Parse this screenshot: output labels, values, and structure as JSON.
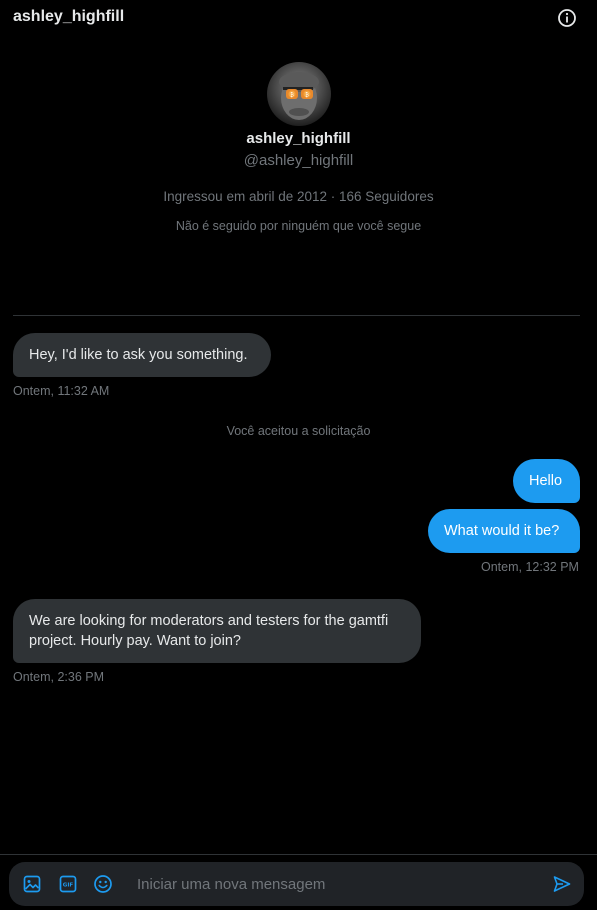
{
  "header": {
    "title": "ashley_highfill",
    "info_icon": "info-circle-icon"
  },
  "profile": {
    "name": "ashley_highfill",
    "handle": "@ashley_highfill",
    "meta": "Ingressou em abril de 2012 · 166 Seguidores",
    "mutuals": "Não é seguido por ninguém que você segue"
  },
  "messages": [
    {
      "direction": "in",
      "text": "Hey, I'd like to ask you something.",
      "timestamp": "Ontem, 11:32 AM"
    },
    {
      "direction": "system",
      "text": "Você aceitou a solicitação"
    },
    {
      "direction": "out",
      "text": "Hello"
    },
    {
      "direction": "out",
      "text": "What would it be?",
      "timestamp": "Ontem, 12:32 PM"
    },
    {
      "direction": "in",
      "text": "We are looking for moderators and testers for the gamtfi project. Hourly pay. Want to join?",
      "timestamp": "Ontem, 2:36 PM"
    }
  ],
  "composer": {
    "placeholder": "Iniciar uma nova mensagem",
    "icons": [
      "image-icon",
      "gif-icon",
      "emoji-icon",
      "send-icon"
    ]
  },
  "colors": {
    "background": "#000000",
    "accent": "#1d9bf0",
    "incoming_bubble": "#2f3336",
    "muted_text": "#71767b",
    "composer_bg": "#202327"
  }
}
